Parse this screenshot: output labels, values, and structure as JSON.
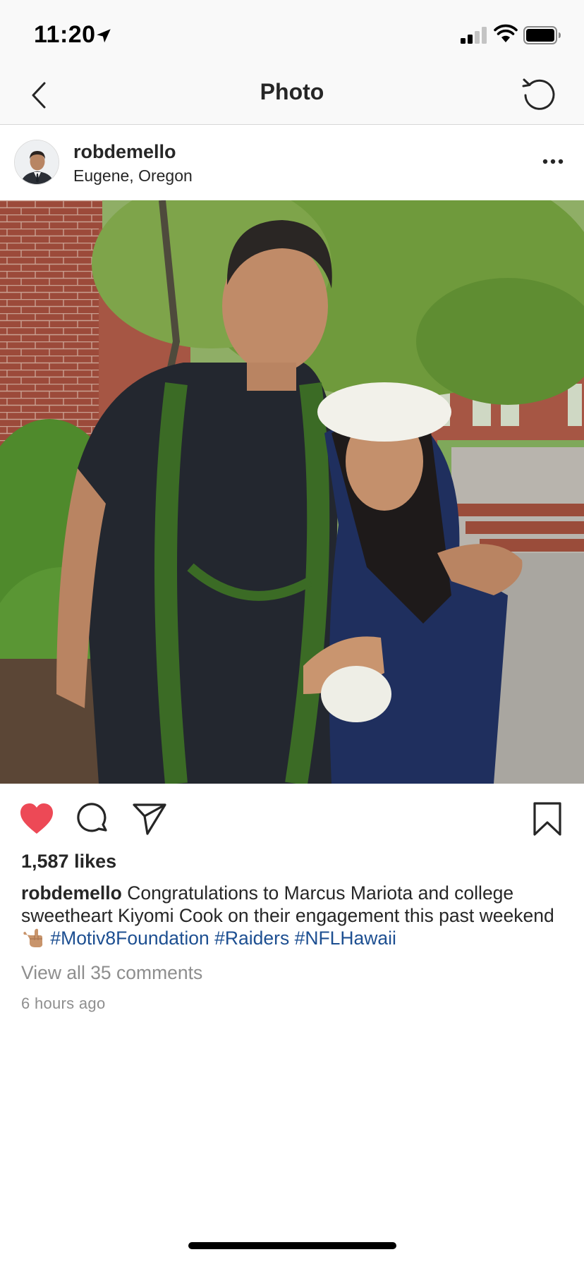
{
  "status_bar": {
    "time": "11:20",
    "icons": [
      "location-arrow-icon",
      "cellular-signal-icon",
      "wifi-icon",
      "battery-icon"
    ]
  },
  "nav": {
    "title": "Photo",
    "back_icon": "chevron-left-icon",
    "refresh_icon": "refresh-icon"
  },
  "post": {
    "username": "robdemello",
    "location": "Eugene, Oregon",
    "more_icon": "ellipsis-icon",
    "photo_icon": "photo",
    "actions": {
      "like_icon": "heart-filled-icon",
      "like_color": "#ed4956",
      "comment_icon": "comment-icon",
      "share_icon": "send-icon",
      "save_icon": "bookmark-icon"
    },
    "likes": "1,587 likes",
    "caption": {
      "user": "robdemello",
      "text": "Congratulations to Marcus Mariota and college sweetheart Kiyomi Cook on their engagement this past weekend",
      "emoji_icon": "call-me-hand-emoji",
      "hashtags": [
        "#Motiv8Foundation",
        "#Raiders",
        "#NFLHawaii"
      ],
      "hashtag_color": "#1d4f91"
    },
    "view_comments": "View all 35 comments",
    "timestamp": "6 hours ago"
  }
}
